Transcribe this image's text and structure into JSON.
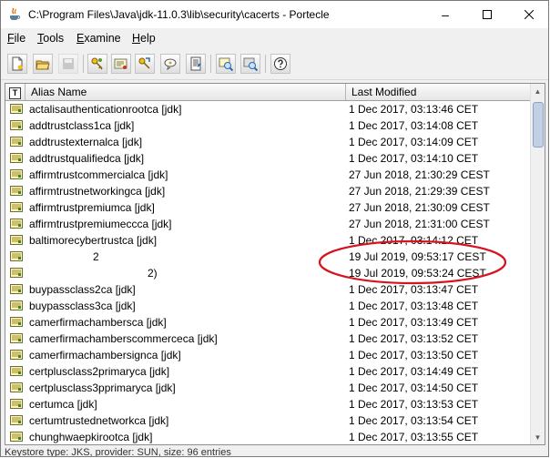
{
  "window": {
    "title": "C:\\Program Files\\Java\\jdk-11.0.3\\lib\\security\\cacerts - Portecle"
  },
  "menu": [
    {
      "label": "File",
      "key": "F",
      "rest": "ile"
    },
    {
      "label": "Tools",
      "key": "T",
      "rest": "ools"
    },
    {
      "label": "Examine",
      "key": "E",
      "rest": "xamine"
    },
    {
      "label": "Help",
      "key": "H",
      "rest": "elp"
    }
  ],
  "toolbar_icons": [
    "new-keystore-icon",
    "open-keystore-icon",
    "save-keystore-icon",
    "generate-keypair-icon",
    "import-trusted-cert-icon",
    "import-keypair-icon",
    "set-password-icon",
    "keystore-report-icon",
    "examine-certificate-icon",
    "examine-ssl-icon",
    "help-icon"
  ],
  "table": {
    "type_header": "T",
    "columns": [
      "Alias Name",
      "Last Modified"
    ],
    "rows": [
      {
        "alias": "actalisauthenticationrootca [jdk]",
        "modified": "1 Dec 2017, 03:13:46 CET"
      },
      {
        "alias": "addtrustclass1ca [jdk]",
        "modified": "1 Dec 2017, 03:14:08 CET"
      },
      {
        "alias": "addtrustexternalca [jdk]",
        "modified": "1 Dec 2017, 03:14:09 CET"
      },
      {
        "alias": "addtrustqualifiedca [jdk]",
        "modified": "1 Dec 2017, 03:14:10 CET"
      },
      {
        "alias": "affirmtrustcommercialca [jdk]",
        "modified": "27 Jun 2018, 21:30:29 CEST"
      },
      {
        "alias": "affirmtrustnetworkingca [jdk]",
        "modified": "27 Jun 2018, 21:29:39 CEST"
      },
      {
        "alias": "affirmtrustpremiumca [jdk]",
        "modified": "27 Jun 2018, 21:30:09 CEST"
      },
      {
        "alias": "affirmtrustpremiumeccca [jdk]",
        "modified": "27 Jun 2018, 21:31:00 CEST"
      },
      {
        "alias": "baltimorecybertrustca [jdk]",
        "modified": "1 Dec 2017, 03:14:12 CET"
      },
      {
        "alias": "2",
        "modified": "19 Jul 2019, 09:53:17 CEST",
        "blurred": true
      },
      {
        "alias": "2)",
        "modified": "19 Jul 2019, 09:53:24 CEST",
        "blurred": true
      },
      {
        "alias": "buypassclass2ca [jdk]",
        "modified": "1 Dec 2017, 03:13:47 CET"
      },
      {
        "alias": "buypassclass3ca [jdk]",
        "modified": "1 Dec 2017, 03:13:48 CET"
      },
      {
        "alias": "camerfirmachambersca [jdk]",
        "modified": "1 Dec 2017, 03:13:49 CET"
      },
      {
        "alias": "camerfirmachamberscommerceca [jdk]",
        "modified": "1 Dec 2017, 03:13:52 CET"
      },
      {
        "alias": "camerfirmachambersignca [jdk]",
        "modified": "1 Dec 2017, 03:13:50 CET"
      },
      {
        "alias": "certplusclass2primaryca [jdk]",
        "modified": "1 Dec 2017, 03:14:49 CET"
      },
      {
        "alias": "certplusclass3pprimaryca [jdk]",
        "modified": "1 Dec 2017, 03:14:50 CET"
      },
      {
        "alias": "certumca [jdk]",
        "modified": "1 Dec 2017, 03:13:53 CET"
      },
      {
        "alias": "certumtrustednetworkca [jdk]",
        "modified": "1 Dec 2017, 03:13:54 CET"
      },
      {
        "alias": "chunghwaepkirootca [jdk]",
        "modified": "1 Dec 2017, 03:13:55 CET"
      }
    ]
  },
  "status": "Keystore type: JKS, provider: SUN, size: 96 entries",
  "colors": {
    "annotation": "#d6141e",
    "selection_thumb": "#c1d0e4"
  }
}
